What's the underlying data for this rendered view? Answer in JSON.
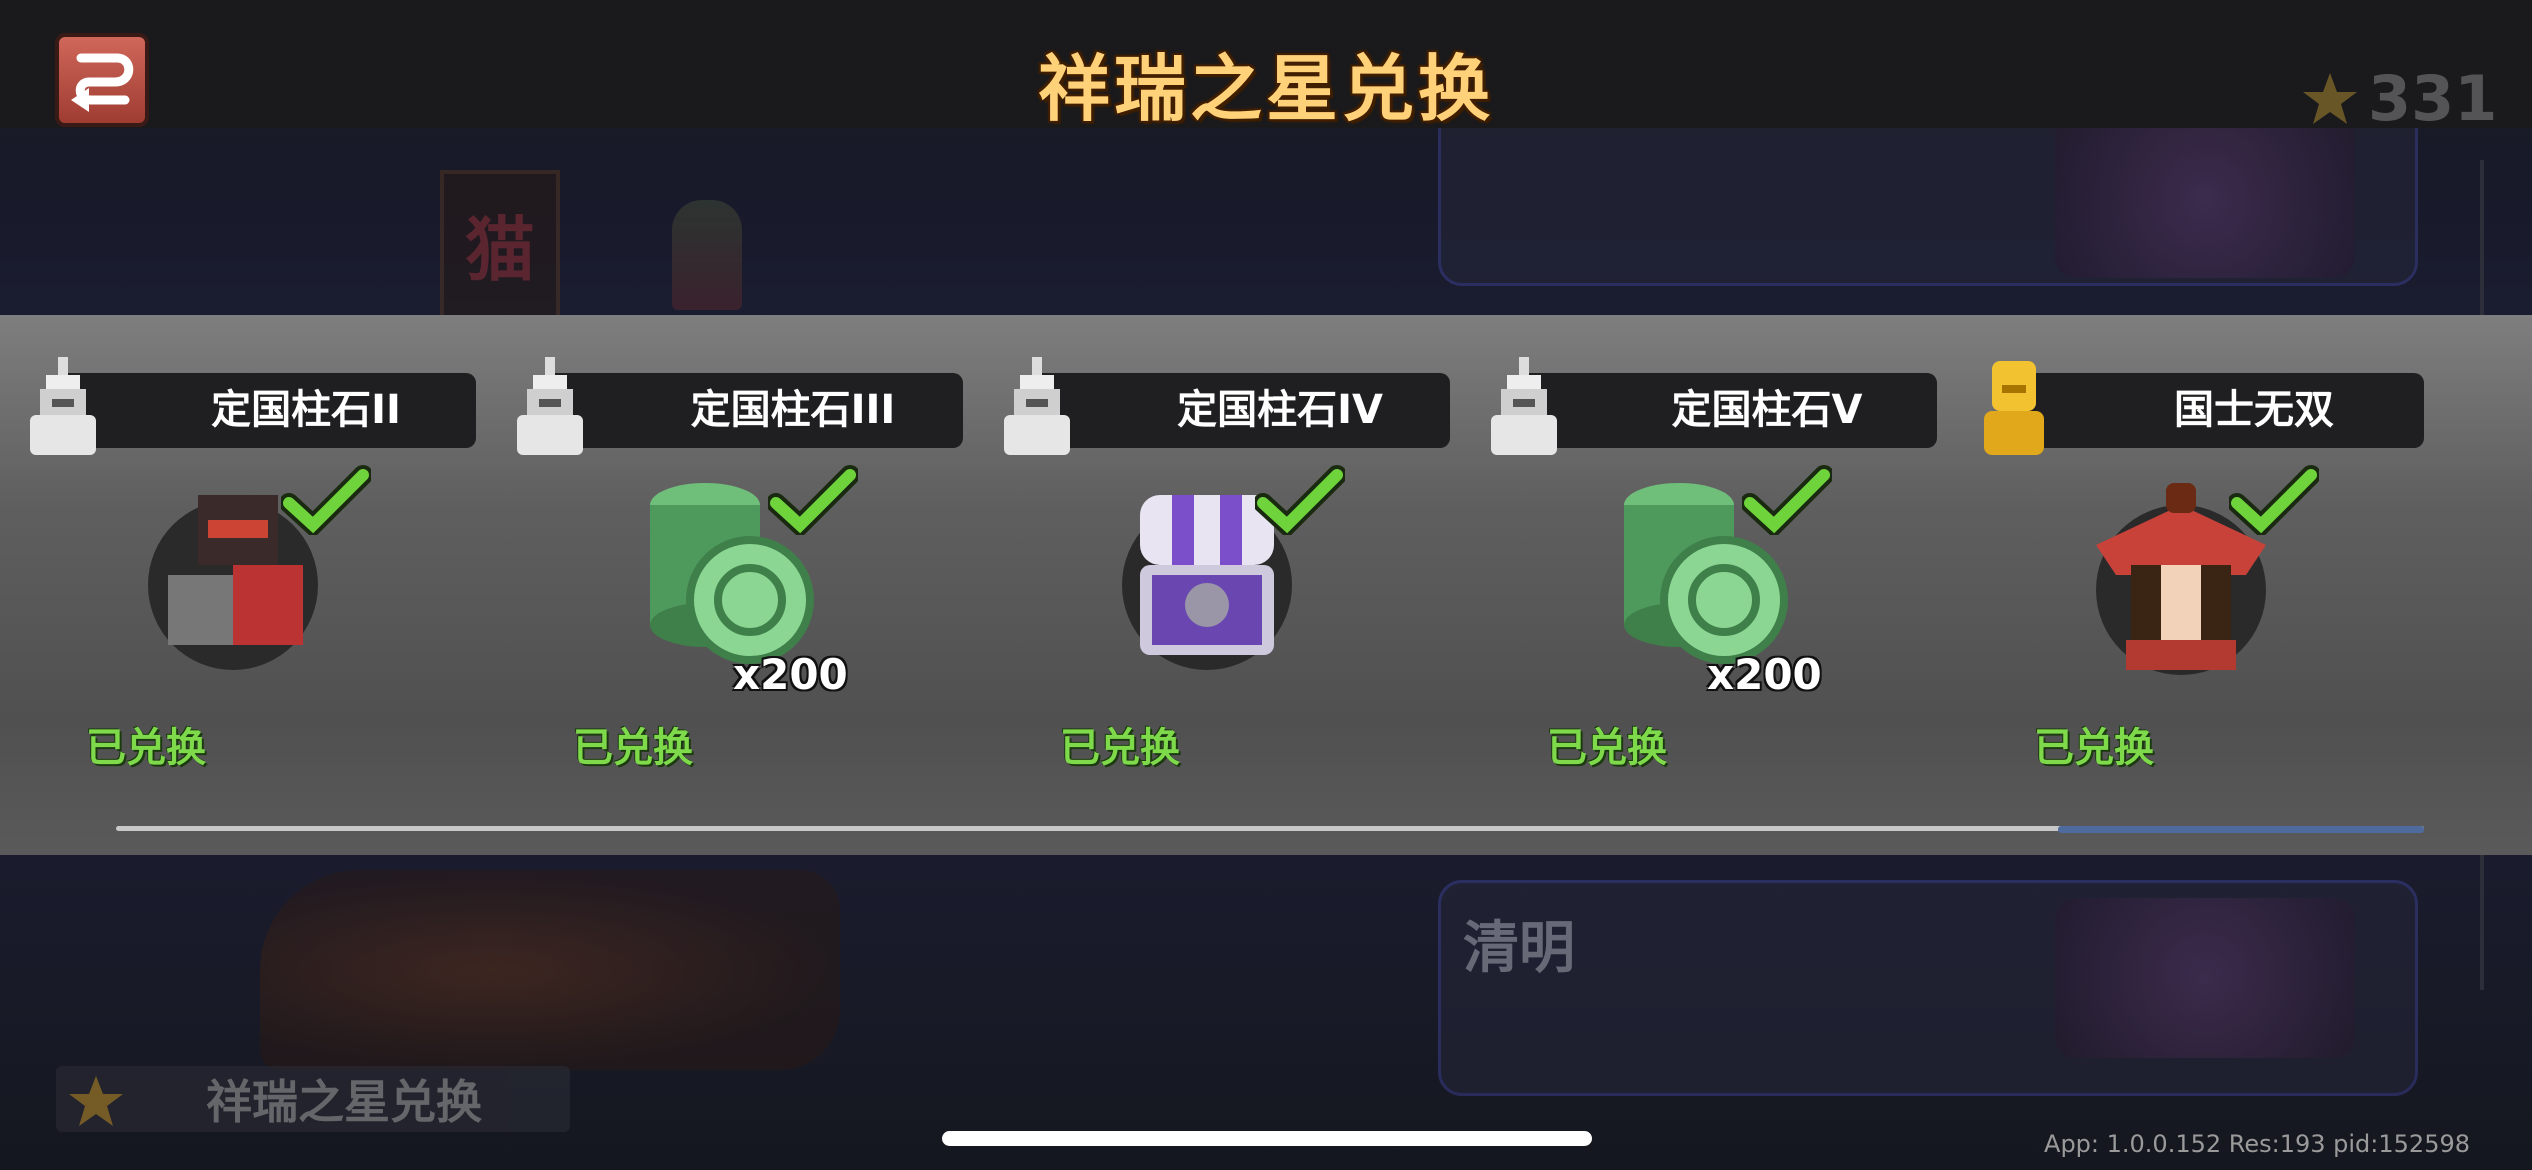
{
  "header": {
    "title": "祥瑞之星兑换",
    "currency_value": "331"
  },
  "background": {
    "event_bottom_label": "清明",
    "left_banner_label": "祥瑞之星兑换",
    "banner_char": "猫"
  },
  "rewards": [
    {
      "name": "定国柱石II",
      "tier_icon": "statue-icon",
      "reward_icon": "warrior-rider-icon",
      "quantity": "",
      "status": "已兑换"
    },
    {
      "name": "定国柱石III",
      "tier_icon": "statue-icon",
      "reward_icon": "jade-coins-icon",
      "quantity": "x200",
      "status": "已兑换"
    },
    {
      "name": "定国柱石IV",
      "tier_icon": "statue-icon",
      "reward_icon": "purple-chest-icon",
      "quantity": "",
      "status": "已兑换"
    },
    {
      "name": "定国柱石V",
      "tier_icon": "statue-icon",
      "reward_icon": "jade-coins-icon",
      "quantity": "x200",
      "status": "已兑换"
    },
    {
      "name": "国士无双",
      "tier_icon": "gold-statue-icon",
      "reward_icon": "red-hat-hero-icon",
      "quantity": "",
      "status": "已兑换"
    }
  ],
  "footer": {
    "build_info": "App: 1.0.0.152 Res:193 pid:152598"
  },
  "colors": {
    "accent_title": "#ffd27a",
    "status_green": "#7ed94b",
    "check_green": "#6fd33c"
  }
}
